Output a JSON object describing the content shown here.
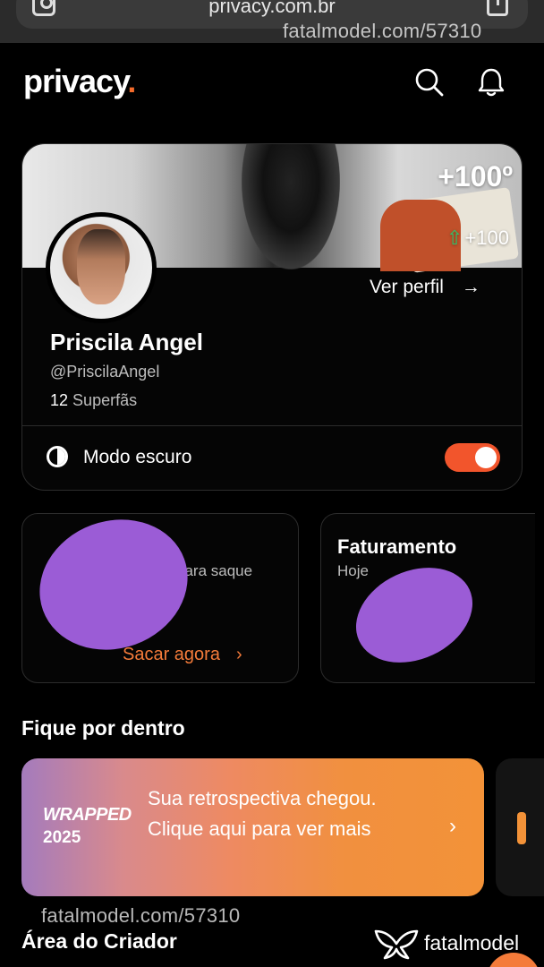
{
  "browser": {
    "url": "privacy.com.br"
  },
  "watermarks": {
    "top": "fatalmodel.com/57310",
    "bottom": "fatalmodel.com/57310",
    "brand": "fatalmodel"
  },
  "header": {
    "logo": "privacy",
    "logo_dot": ".",
    "icons": [
      "search-icon",
      "bell-icon"
    ]
  },
  "profile": {
    "cover_badge_big": "+100º",
    "cover_badge_small": "+100",
    "view_profile": "Ver perfil",
    "name": "Priscila Angel",
    "handle": "@PriscilaAngel",
    "superfans_count": "12",
    "superfans_label": "Superfãs",
    "dark_mode_label": "Modo escuro",
    "dark_mode_on": true
  },
  "cards": {
    "left": {
      "subtitle": "para saque",
      "link": "Sacar agora"
    },
    "right": {
      "title": "Faturamento",
      "subtitle": "Hoje"
    }
  },
  "section": {
    "title": "Fique por dentro"
  },
  "banner": {
    "wrapped": "WRAPPED",
    "year": "2025",
    "message": "Sua retrospectiva chegou. Clique aqui para ver mais"
  },
  "creator": {
    "title": "Área do Criador"
  },
  "colors": {
    "accent": "#f36b2b",
    "toggle": "#f2552c",
    "link": "#f47b3a",
    "background": "#000000"
  }
}
